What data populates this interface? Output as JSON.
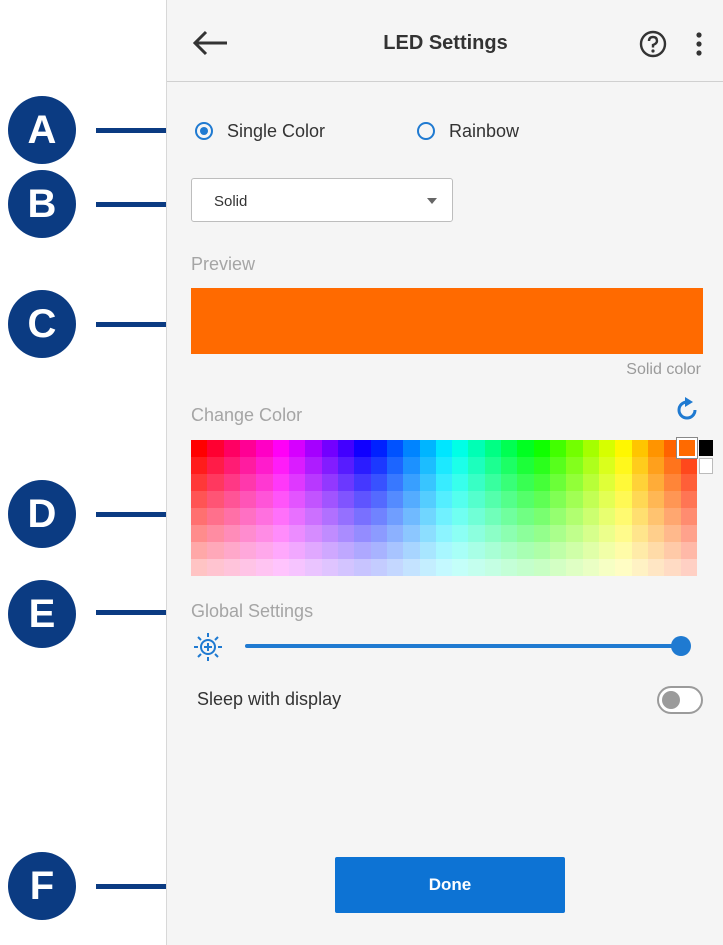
{
  "header": {
    "title": "LED Settings"
  },
  "mode": {
    "options": [
      {
        "label": "Single Color",
        "checked": true
      },
      {
        "label": "Rainbow",
        "checked": false
      }
    ]
  },
  "effect": {
    "selected": "Solid"
  },
  "preview": {
    "label": "Preview",
    "caption": "Solid color",
    "color": "#ff6a00"
  },
  "color": {
    "label": "Change Color",
    "selected": "#ff6a00"
  },
  "global": {
    "label": "Global Settings",
    "brightness": 1.0,
    "sleep_label": "Sleep with display",
    "sleep_enabled": false
  },
  "actions": {
    "done_label": "Done"
  },
  "callouts": [
    "A",
    "B",
    "C",
    "D",
    "E",
    "F"
  ],
  "colors": {
    "accent": "#1f7ad1",
    "callout": "#0b3b82",
    "done": "#0d73d4"
  },
  "icons": [
    "back-arrow-icon",
    "help-icon",
    "more-vert-icon",
    "reset-icon",
    "brightness-icon"
  ]
}
